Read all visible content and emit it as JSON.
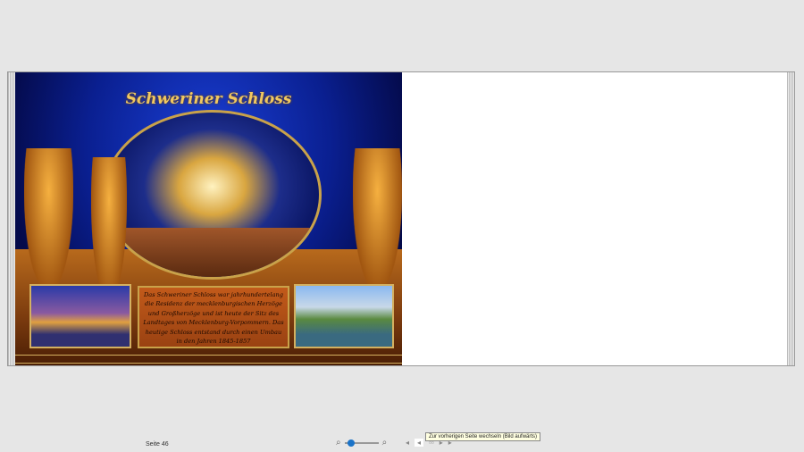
{
  "page": {
    "title": "Schweriner Schloss",
    "body_text": "Das Schweriner Schloss war jahrhundertelang die Residenz der mecklenburgischen Herzöge und Großherzöge und ist heute der Sitz des Landtages von Mecklenburg-Vorpommern. Das heutige Schloss entstand durch einen Umbau in den Jahren 1845-1857"
  },
  "statusbar": {
    "page_label": "Seite 46",
    "zoom_level": 0.1,
    "tooltip": "Zur vorherigen Seite wechseln (Bild aufwärts)"
  }
}
